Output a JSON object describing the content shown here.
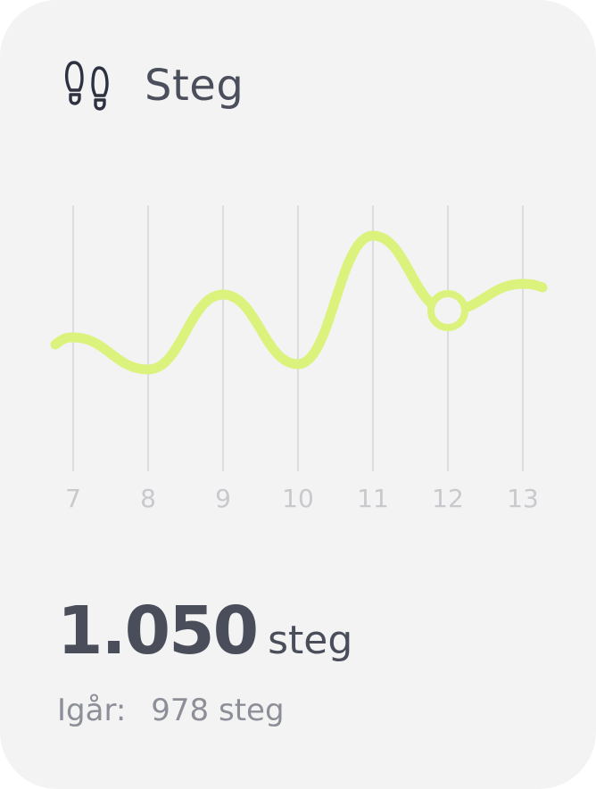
{
  "header": {
    "title": "Steg",
    "icon": "footsteps-icon",
    "icon_color": "#2e3140"
  },
  "chart_data": {
    "type": "line",
    "x": [
      7,
      8,
      9,
      10,
      11,
      12,
      13
    ],
    "values": [
      378,
      414,
      330,
      408,
      264,
      348,
      318
    ],
    "ylim": [
      200,
      500
    ],
    "grid": "vertical",
    "highlight_x": 12,
    "line_color": "#dbf27c",
    "grid_color": "#dcdcde"
  },
  "summary": {
    "total_value": "1.050",
    "total_unit": "steg",
    "yesterday_label": "Igår:",
    "yesterday_value": "978 steg"
  }
}
